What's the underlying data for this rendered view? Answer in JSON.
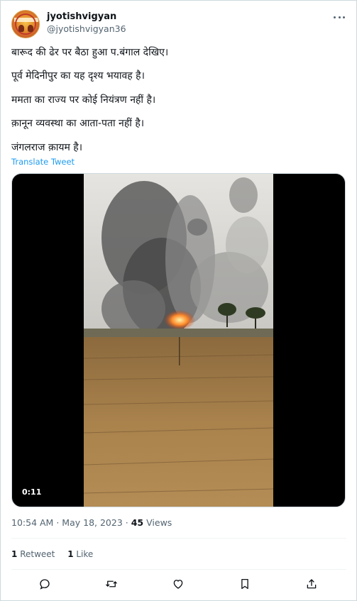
{
  "author": {
    "display_name": "jyotishvigyan",
    "handle": "@jyotishvigyan36",
    "avatar_icon": "profile-avatar"
  },
  "tweet": {
    "lines": [
      "बारूद की ढेर पर बैठा हुआ प.बंगाल देखिए।",
      "पूर्व मेदिनीपुर का यह दृश्य भयावह है।",
      "ममता का राज्य पर कोई नियंत्रण नहीं है।",
      "क़ानून व्यवस्था का आता-पता नहीं है।",
      "जंगलराज क़ायम है।"
    ],
    "translate_label": "Translate Tweet"
  },
  "media": {
    "duration": "0:11"
  },
  "meta": {
    "time": "10:54 AM",
    "separator": "·",
    "date": "May 18, 2023",
    "views_count": "45",
    "views_label": "Views"
  },
  "stats": {
    "retweets_count": "1",
    "retweets_label": "Retweet",
    "likes_count": "1",
    "likes_label": "Like"
  },
  "actions": {
    "icons": [
      "reply-icon",
      "retweet-icon",
      "like-icon",
      "bookmark-icon",
      "share-icon"
    ]
  },
  "colors": {
    "link": "#1d9bf0",
    "secondary_text": "#536471",
    "primary_text": "#0f1419",
    "border": "#cfd9de"
  }
}
